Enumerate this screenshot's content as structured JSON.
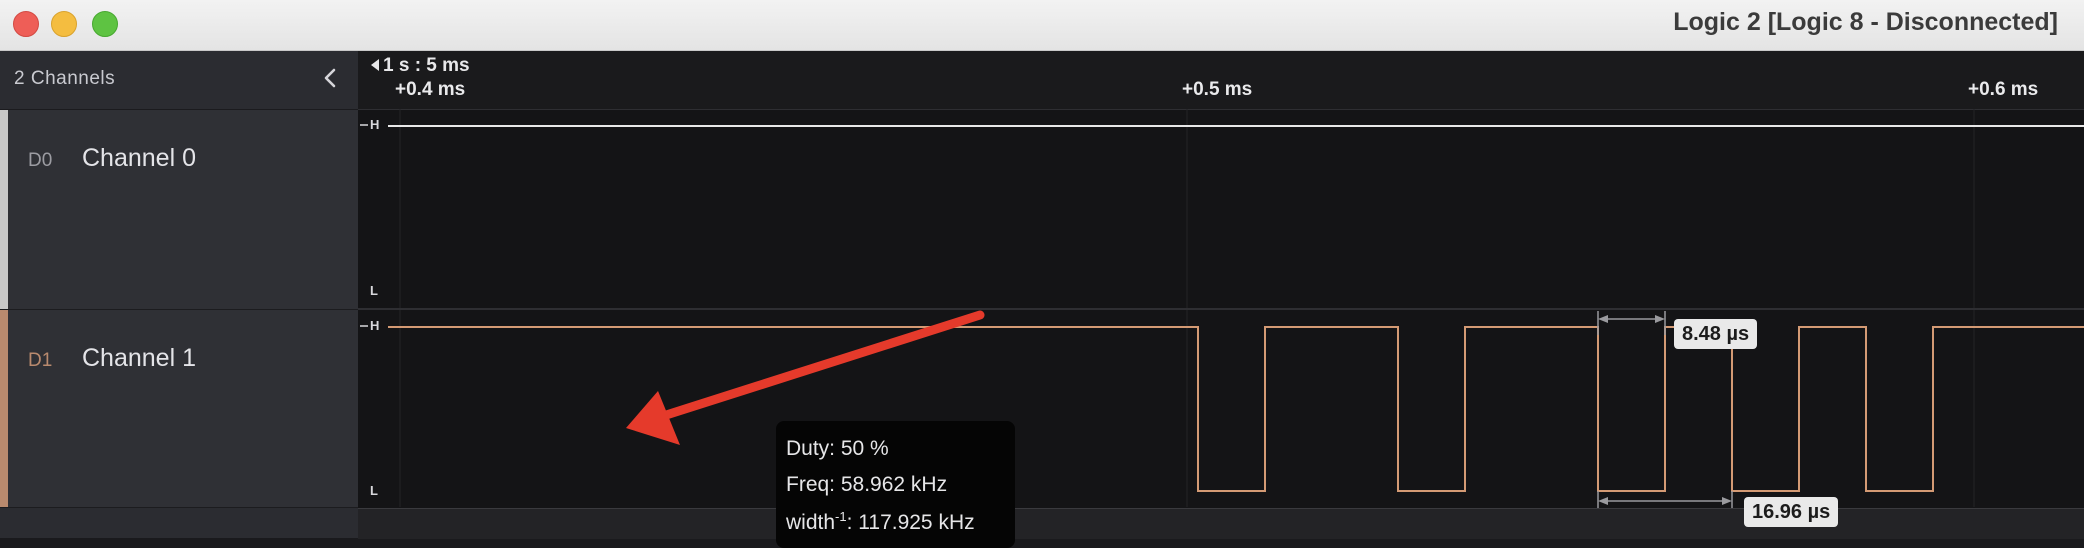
{
  "window": {
    "title": "Logic 2 [Logic 8 - Disconnected]",
    "traffic_lights": [
      "close",
      "minimize",
      "zoom"
    ]
  },
  "sidebar": {
    "channel_count": "2 Channels",
    "collapse_icon": "chevron-left-icon",
    "channels": [
      {
        "code": "D0",
        "name": "Channel 0",
        "color": "#c8c8c8"
      },
      {
        "code": "D1",
        "name": "Channel 1",
        "color": "#b98a6e"
      }
    ]
  },
  "timeline": {
    "reference": "1 s : 5 ms",
    "ticks": [
      "+0.4 ms",
      "+0.5 ms",
      "+0.6 ms"
    ]
  },
  "levels": {
    "high": "H",
    "low": "L"
  },
  "measurement": {
    "duty": "Duty: 50 %",
    "freq": "Freq: 58.962 kHz",
    "width_prefix": "width",
    "width_exp": "-1",
    "width_value": ": 117.925 kHz"
  },
  "width_labels": {
    "pulse": "8.48 µs",
    "period": "16.96 µs"
  },
  "colors": {
    "channel0": "#e8e8e8",
    "channel1": "#d49a74",
    "annotation_arrow": "#e53a2b"
  }
}
